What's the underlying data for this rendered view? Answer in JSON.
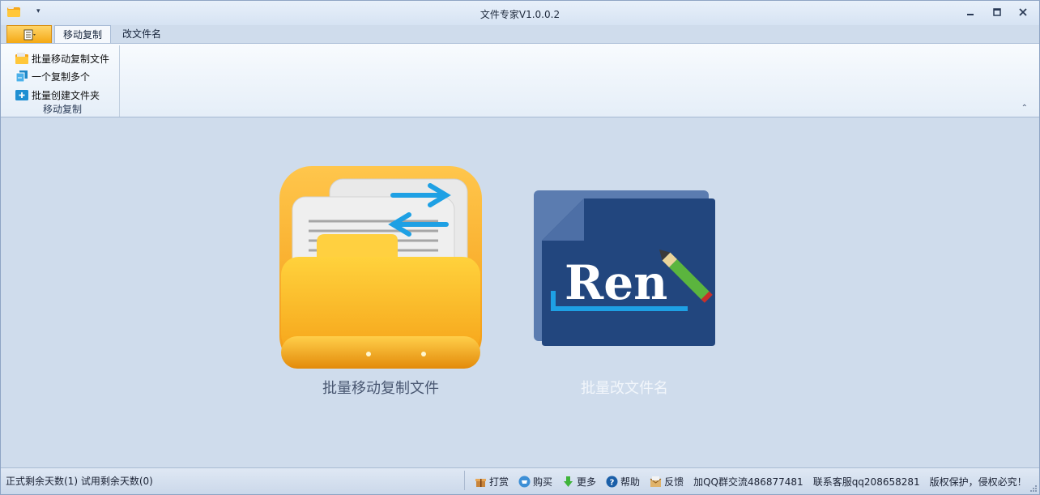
{
  "window": {
    "title": "文件专家V1.0.0.2"
  },
  "tabs": [
    {
      "label": "移动复制"
    },
    {
      "label": "改文件名"
    }
  ],
  "ribbon": {
    "items": [
      {
        "label": "批量移动复制文件"
      },
      {
        "label": "一个复制多个"
      },
      {
        "label": "批量创建文件夹"
      }
    ],
    "group_label": "移动复制"
  },
  "tiles": [
    {
      "label": "批量移动复制文件",
      "color": "#4a5872"
    },
    {
      "label": "批量改文件名",
      "logo_text": "Ren",
      "color": "#f2f6fb"
    }
  ],
  "status": {
    "left": "正式剩余天数(1)  试用剩余天数(0)",
    "items": [
      {
        "label": "打赏",
        "icon": "gift-icon"
      },
      {
        "label": "购买",
        "icon": "cart-icon"
      },
      {
        "label": "更多",
        "icon": "down-arrow-icon"
      },
      {
        "label": "帮助",
        "icon": "help-icon"
      },
      {
        "label": "反馈",
        "icon": "feedback-icon"
      }
    ],
    "qq_group": "加QQ群交流486877481",
    "service": "联系客服qq208658281",
    "copyright": "版权保护，侵权必究！"
  },
  "colors": {
    "orange": "#f6a71a",
    "ren_blue": "#22467e",
    "accent_blue": "#1ea0e4"
  }
}
